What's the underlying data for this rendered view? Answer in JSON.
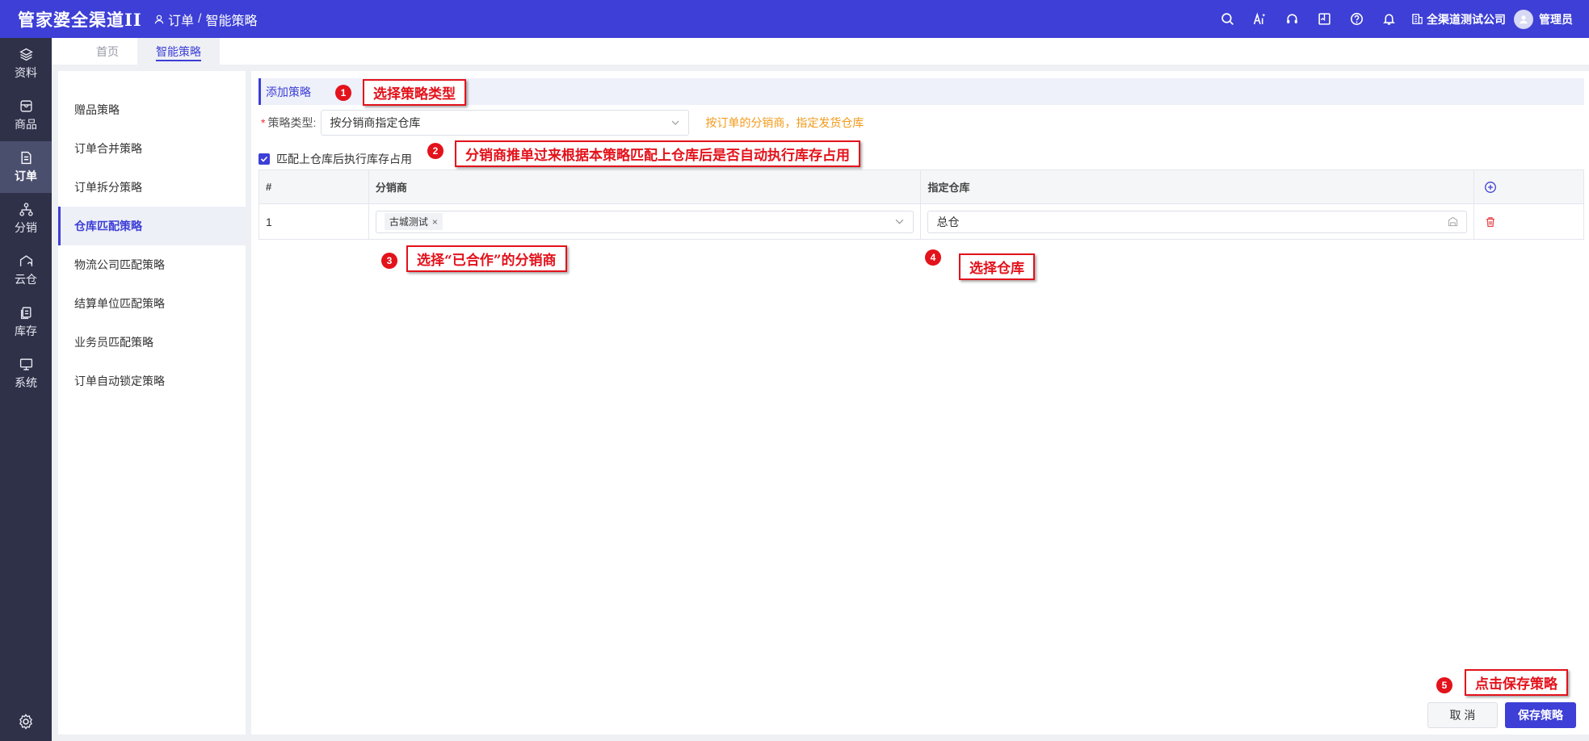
{
  "header": {
    "logo": "管家婆全渠道II",
    "breadcrumb": [
      "订单",
      "智能策略"
    ],
    "company": "全渠道测试公司",
    "user": "管理员",
    "icons": [
      "search-icon",
      "ai-icon",
      "headset-icon",
      "book-icon",
      "help-icon",
      "bell-icon"
    ],
    "brand_color": "#3d3fd6"
  },
  "nav": {
    "items": [
      {
        "label": "资料",
        "icon": "layers-icon"
      },
      {
        "label": "商品",
        "icon": "box-icon"
      },
      {
        "label": "订单",
        "icon": "order-icon",
        "active": true
      },
      {
        "label": "分销",
        "icon": "network-icon"
      },
      {
        "label": "云仓",
        "icon": "cloud-warehouse-icon"
      },
      {
        "label": "库存",
        "icon": "inventory-icon"
      },
      {
        "label": "系统",
        "icon": "monitor-icon"
      }
    ]
  },
  "tabs": [
    {
      "label": "首页"
    },
    {
      "label": "智能策略",
      "active": true
    }
  ],
  "strategy_menu": [
    "赠品策略",
    "订单合并策略",
    "订单拆分策略",
    "仓库匹配策略",
    "物流公司匹配策略",
    "结算单位匹配策略",
    "业务员匹配策略",
    "订单自动锁定策略"
  ],
  "form": {
    "section_title": "添加策略",
    "type_label": "策略类型:",
    "type_value": "按分销商指定仓库",
    "type_hint": "按订单的分销商，指定发货仓库",
    "checkbox_label": "匹配上仓库后执行库存占用",
    "checkbox_checked": true
  },
  "table": {
    "headers": [
      "#",
      "分销商",
      "指定仓库"
    ],
    "rows": [
      {
        "index": "1",
        "distributor_tag": "古城测试",
        "warehouse": "总仓"
      }
    ]
  },
  "buttons": {
    "cancel": "取 消",
    "save": "保存策略"
  },
  "annotations": [
    {
      "num": "1",
      "text": "选择策略类型"
    },
    {
      "num": "2",
      "text": "分销商推单过来根据本策略匹配上仓库后是否自动执行库存占用"
    },
    {
      "num": "3",
      "text": "选择“已合作”的分销商"
    },
    {
      "num": "4",
      "text": "选择仓库"
    },
    {
      "num": "5",
      "text": "点击保存策略"
    }
  ],
  "annotation_color": "#e3121b"
}
